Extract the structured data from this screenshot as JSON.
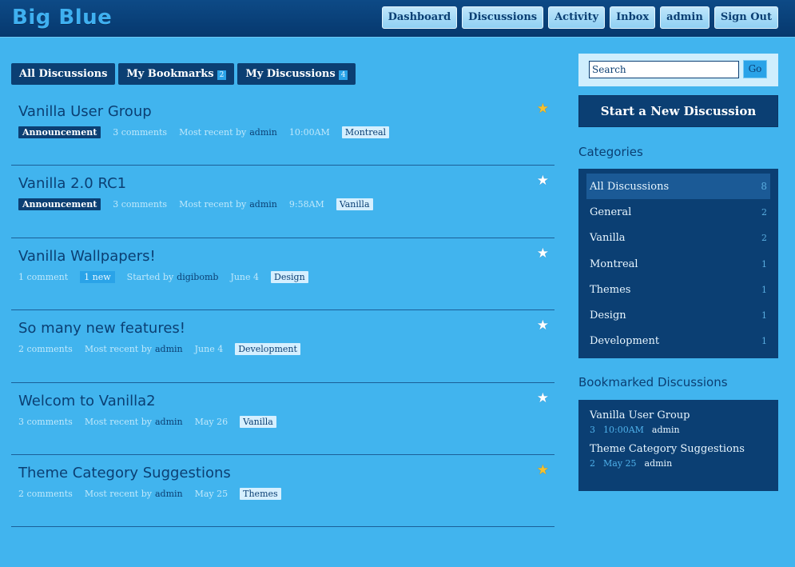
{
  "header": {
    "logo": "Big Blue",
    "nav": [
      "Dashboard",
      "Discussions",
      "Activity",
      "Inbox",
      "admin",
      "Sign Out"
    ]
  },
  "tabs": [
    {
      "label": "All Discussions",
      "count": ""
    },
    {
      "label": "My Bookmarks",
      "count": "2"
    },
    {
      "label": "My Discussions",
      "count": "4"
    }
  ],
  "discussions": [
    {
      "title": "Vanilla User Group",
      "starred": true,
      "announcement": "Announcement",
      "comments": "3 comments",
      "new": "",
      "by_label": "Most recent by",
      "user": "admin",
      "when": "10:00AM",
      "category": "Montreal"
    },
    {
      "title": "Vanilla 2.0 RC1",
      "starred": false,
      "announcement": "Announcement",
      "comments": "3 comments",
      "new": "",
      "by_label": "Most recent by",
      "user": "admin",
      "when": "9:58AM",
      "category": "Vanilla"
    },
    {
      "title": "Vanilla Wallpapers!",
      "starred": false,
      "announcement": "",
      "comments": "1 comment",
      "new": "1 new",
      "by_label": "Started by",
      "user": "digibomb",
      "when": "June 4",
      "category": "Design"
    },
    {
      "title": "So many new features!",
      "starred": false,
      "announcement": "",
      "comments": "2 comments",
      "new": "",
      "by_label": "Most recent by",
      "user": "admin",
      "when": "June 4",
      "category": "Development"
    },
    {
      "title": "Welcom to Vanilla2",
      "starred": false,
      "announcement": "",
      "comments": "3 comments",
      "new": "",
      "by_label": "Most recent by",
      "user": "admin",
      "when": "May 26",
      "category": "Vanilla"
    },
    {
      "title": "Theme Category Suggestions",
      "starred": true,
      "announcement": "",
      "comments": "2 comments",
      "new": "",
      "by_label": "Most recent by",
      "user": "admin",
      "when": "May 25",
      "category": "Themes"
    }
  ],
  "sidebar": {
    "search_placeholder": "Search",
    "go_label": "Go",
    "start_label": "Start a New Discussion",
    "categories_heading": "Categories",
    "categories": [
      {
        "name": "All Discussions",
        "count": "8",
        "active": true
      },
      {
        "name": "General",
        "count": "2",
        "active": false
      },
      {
        "name": "Vanilla",
        "count": "2",
        "active": false
      },
      {
        "name": "Montreal",
        "count": "1",
        "active": false
      },
      {
        "name": "Themes",
        "count": "1",
        "active": false
      },
      {
        "name": "Design",
        "count": "1",
        "active": false
      },
      {
        "name": "Development",
        "count": "1",
        "active": false
      }
    ],
    "bookmarks_heading": "Bookmarked Discussions",
    "bookmarks": [
      {
        "title": "Vanilla User Group",
        "count": "3",
        "when": "10:00AM",
        "user": "admin"
      },
      {
        "title": "Theme Category Suggestions",
        "count": "2",
        "when": "May 25",
        "user": "admin"
      }
    ]
  },
  "icons": {
    "star": "star-icon"
  },
  "colors": {
    "background": "#41b4ee",
    "navy": "#0b3f73",
    "accent": "#2aa3e8",
    "star_on": "#f6c12d"
  }
}
